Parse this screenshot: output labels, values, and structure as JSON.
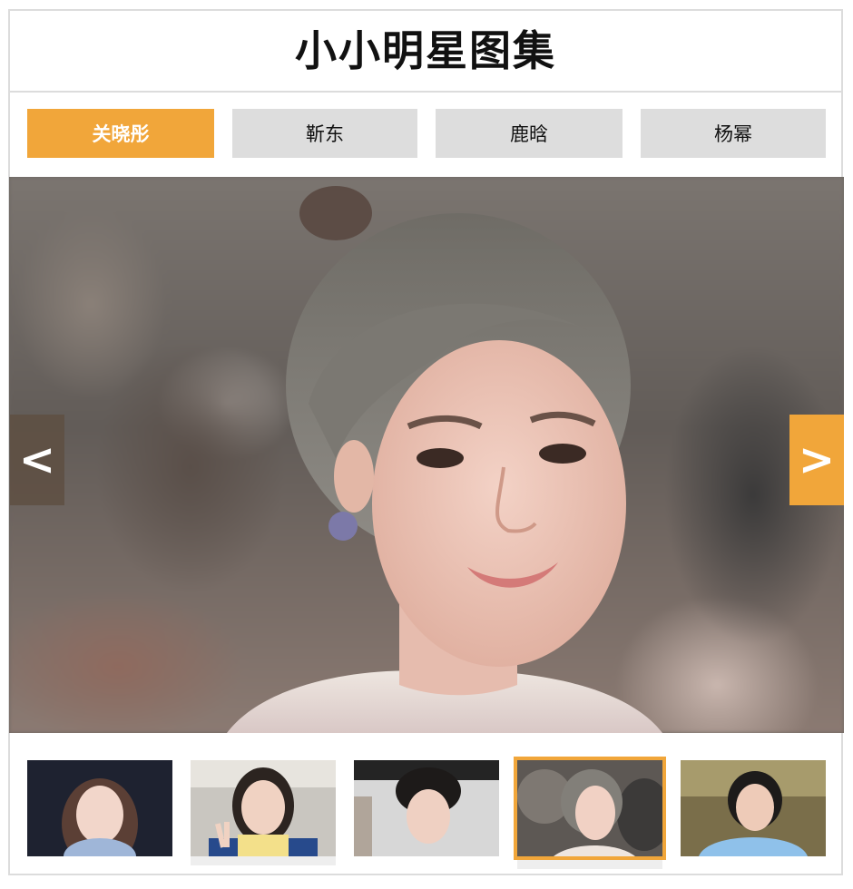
{
  "page": {
    "title": "小小明星图集"
  },
  "tabs": [
    {
      "label": "关晓彤",
      "active": true
    },
    {
      "label": "靳东",
      "active": false
    },
    {
      "label": "鹿晗",
      "active": false
    },
    {
      "label": "杨幂",
      "active": false
    }
  ],
  "slider": {
    "prev_label": "<",
    "next_label": ">",
    "active_index": 3
  },
  "thumbnails": [
    {
      "selected": false
    },
    {
      "selected": false
    },
    {
      "selected": false
    },
    {
      "selected": true
    },
    {
      "selected": false
    }
  ],
  "colors": {
    "accent": "#f1a63a",
    "tab_inactive": "#dddddd",
    "border": "#dcdcdc",
    "prev_arrow": "#5e4f42"
  }
}
